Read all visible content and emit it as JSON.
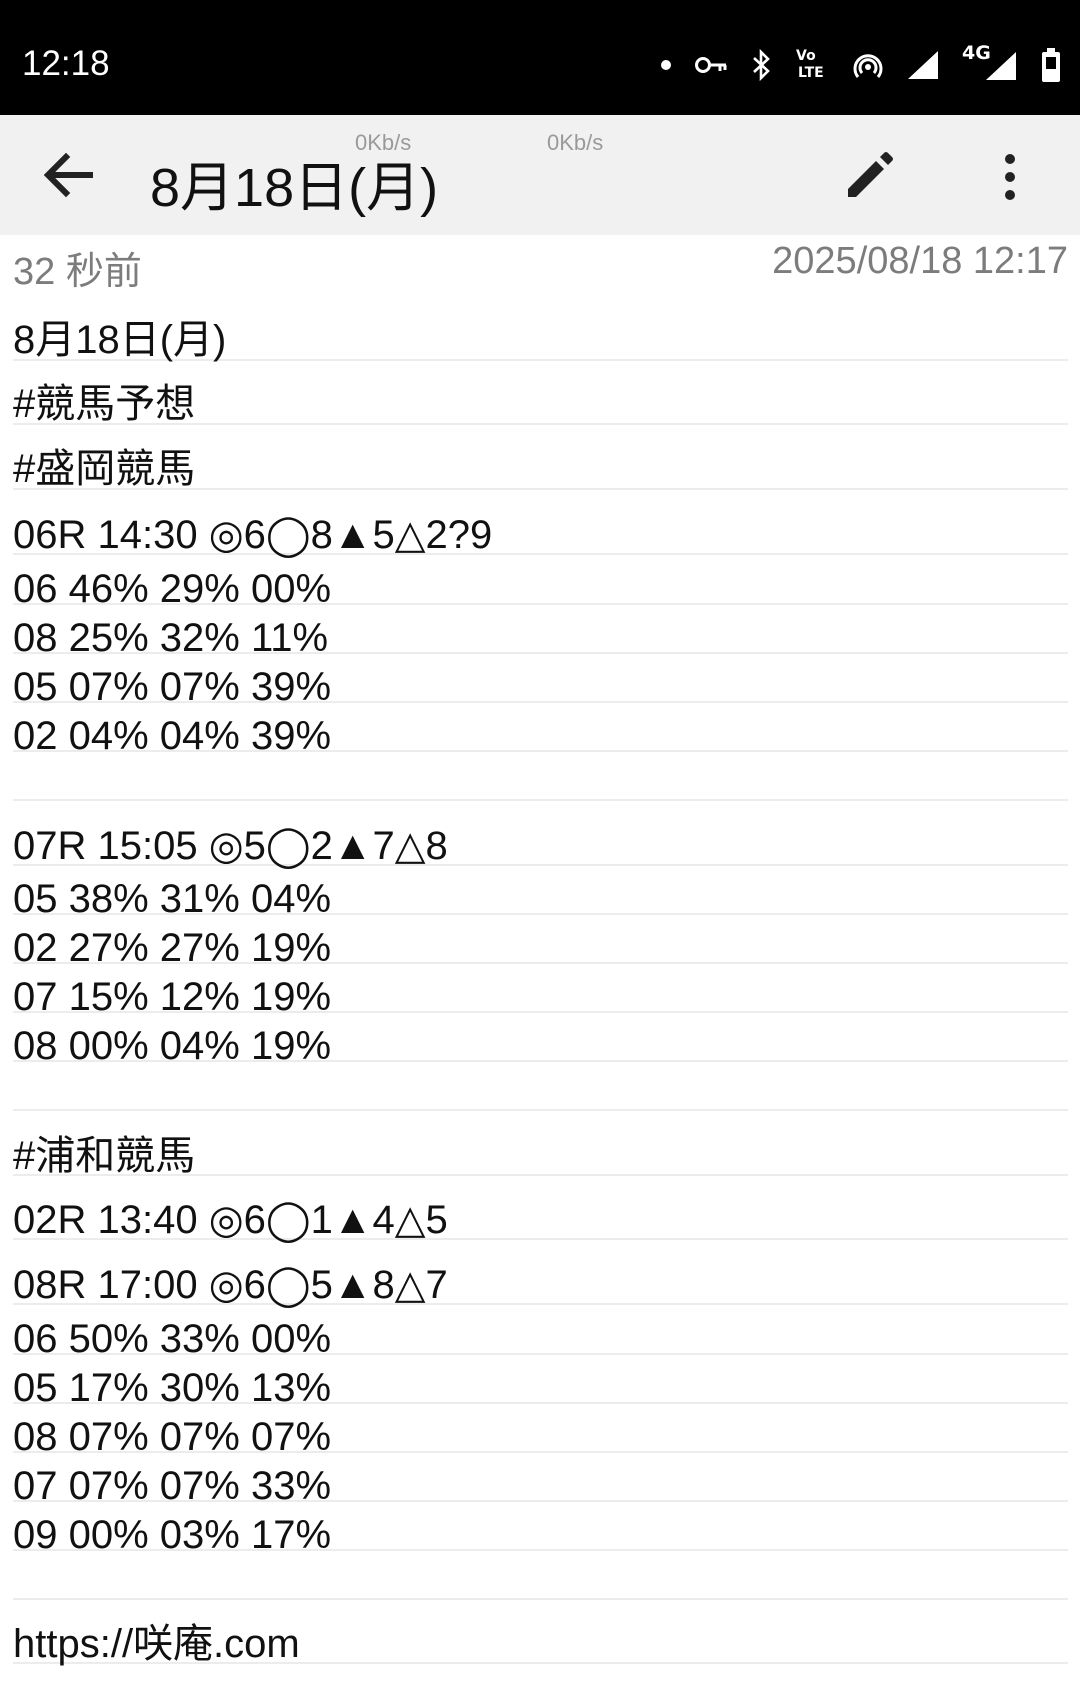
{
  "status_bar": {
    "time": "12:18",
    "icons": [
      "dot-icon",
      "vpn-key-icon",
      "bluetooth-icon",
      "volte-icon",
      "hotspot-icon",
      "signal-icon",
      "4g-signal-icon",
      "battery-icon"
    ],
    "volte_label_top": "Vo",
    "volte_label_bottom": "LTE",
    "network_label": "4G"
  },
  "toolbar": {
    "title": "8月18日(月)",
    "speed_left": "0Kb/s",
    "speed_right": "0Kb/s"
  },
  "meta": {
    "relative_time": "32 秒前",
    "timestamp": "2025/08/18 12:17"
  },
  "note_lines": [
    "8月18日(月)",
    "#競馬予想",
    "#盛岡競馬",
    "06R 14:30 ◎6◯8▲5△2?9",
    "06 46% 29% 00%",
    "08 25% 32% 11%",
    "05 07% 07% 39%",
    "02 04% 04% 39%",
    "",
    "07R 15:05 ◎5◯2▲7△8",
    "05 38% 31% 04%",
    "02 27% 27% 19%",
    "07 15% 12% 19%",
    "08 00% 04% 19%",
    "",
    "#浦和競馬",
    "02R 13:40 ◎6◯1▲4△5",
    "08R 17:00 ◎6◯5▲8△7",
    "06 50% 33% 00%",
    "05 17% 30% 13%",
    "08 07% 07% 07%",
    "07 07% 07% 33%",
    "09 00% 03% 17%",
    "",
    "https://咲庵.com"
  ]
}
